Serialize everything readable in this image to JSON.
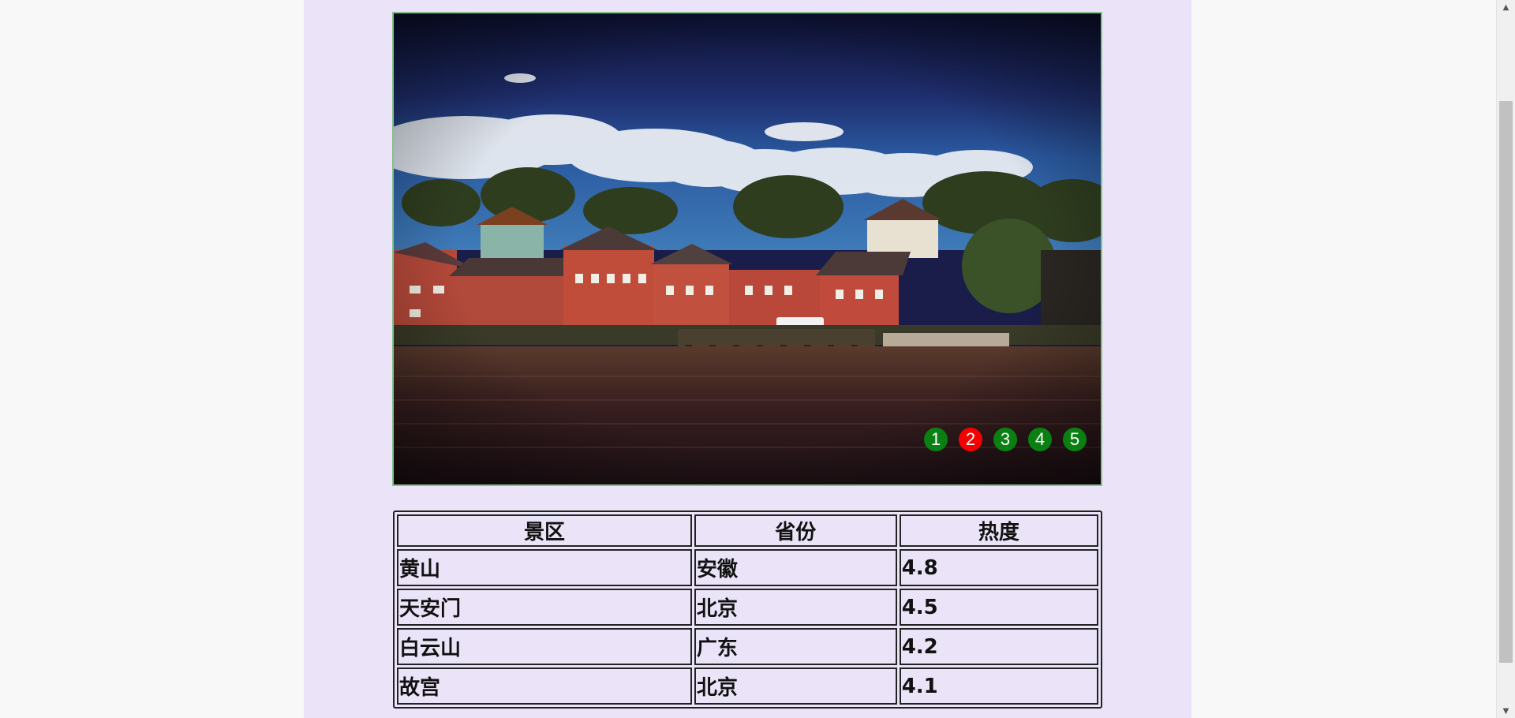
{
  "slider": {
    "dots": [
      "1",
      "2",
      "3",
      "4",
      "5"
    ],
    "active_dot": "2",
    "image_alt": ""
  },
  "table": {
    "headers": [
      "景区",
      "省份",
      "热度"
    ],
    "rows": [
      [
        "黄山",
        "安徽",
        "4.8"
      ],
      [
        "天安门",
        "北京",
        "4.5"
      ],
      [
        "白云山",
        "广东",
        "4.2"
      ],
      [
        "故宫",
        "北京",
        "4.1"
      ]
    ]
  },
  "colors": {
    "page_background": "#f8f8f8",
    "panel_background": "#ebe4f8",
    "dot_inactive": "#0a8012",
    "dot_active": "#f40000",
    "slider_border": "#84c08c"
  },
  "scrollbar": {
    "up_icon": "chevron-up-icon",
    "down_icon": "chevron-down-icon"
  }
}
